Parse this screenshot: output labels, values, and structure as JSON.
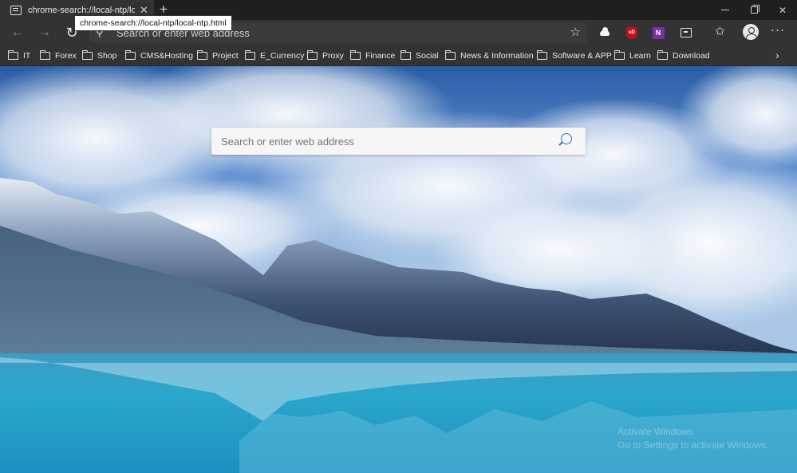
{
  "tab": {
    "title": "chrome-search://local-ntp/local-ntp.html",
    "close": "✕"
  },
  "new_tab": "+",
  "tooltip": "chrome-search://local-ntp/local-ntp.html",
  "window_controls": {
    "close": "✕"
  },
  "toolbar": {
    "back": "←",
    "forward": "→",
    "reload": "↻",
    "search_glyph": "⚲",
    "address_placeholder": "Search or enter web address",
    "star": "☆",
    "favorites": "✩",
    "more": "···",
    "extensions": {
      "ublock": "uD",
      "onenote": "N"
    }
  },
  "favorites_bar": {
    "items": [
      "IT",
      "Forex",
      "Shop",
      "CMS&Hosting",
      "Project",
      "E_Currency",
      "Proxy",
      "Finance",
      "Social",
      "News & Information",
      "Software & APP",
      "Learn",
      "Download"
    ],
    "more": "›"
  },
  "ntp": {
    "search_placeholder": "Search or enter web address"
  },
  "watermark": {
    "line1": "Activate Windows",
    "line2": "Go to Settings to activate Windows."
  }
}
